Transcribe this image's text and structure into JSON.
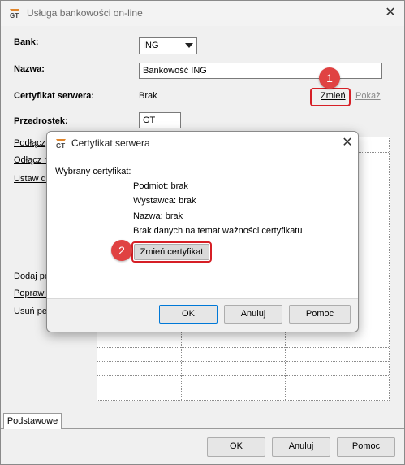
{
  "main_window": {
    "title": "Usługa bankowości on-line",
    "bank_label": "Bank:",
    "bank_value": "ING",
    "name_label": "Nazwa:",
    "name_value": "Bankowość ING",
    "cert_label": "Certyfikat serwera:",
    "cert_value": "Brak",
    "change_link": "Zmień",
    "show_link": "Pokaż",
    "prefix_label": "Przedrostek:",
    "prefix_value": "GT",
    "side_links_top": [
      "Podłącz",
      "Odłącz r",
      "Ustaw da"
    ],
    "side_links_bottom": [
      "Dodaj pe",
      "Popraw p",
      "Usuń pe"
    ],
    "tab_label": "Podstawowe",
    "ok_label": "OK",
    "cancel_label": "Anuluj",
    "help_label": "Pomoc"
  },
  "dialog": {
    "title": "Certyfikat serwera",
    "selected_label": "Wybrany certyfikat:",
    "subject": "Podmiot: brak",
    "issuer": "Wystawca: brak",
    "name": "Nazwa: brak",
    "validity": "Brak danych na temat ważności certyfikatu",
    "change_cert_label": "Zmień certyfikat",
    "ok_label": "OK",
    "cancel_label": "Anuluj",
    "help_label": "Pomoc"
  },
  "annotations": {
    "step1": "1",
    "step2": "2",
    "ring_color": "#d61f26",
    "badge_color": "#e04242"
  },
  "icons": [
    "app-logo-icon",
    "close-icon",
    "chevron-down-icon"
  ]
}
